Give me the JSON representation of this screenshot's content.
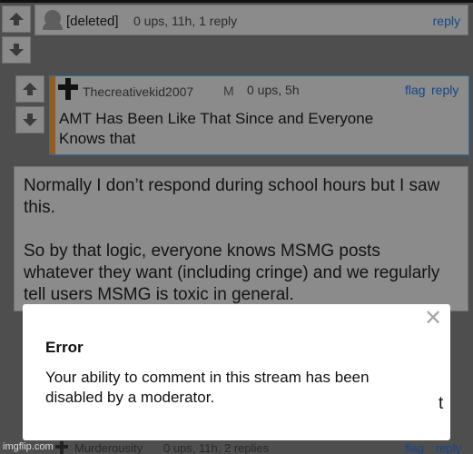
{
  "comment1": {
    "author": "[deleted]",
    "meta": "0 ups, 11h, 1 reply",
    "reply_label": "reply"
  },
  "comment2": {
    "author": "Thecreativekid2007",
    "badge": "M",
    "meta": "0 ups, 5h",
    "flag_label": "flag",
    "reply_label": "reply",
    "text": "AMT Has Been Like That Since and Everyone Knows that"
  },
  "comment3": {
    "paragraph1": "Normally I don’t respond during school hours but I saw this.",
    "paragraph2": "So by that logic, everyone knows MSMG posts whatever they want (including cringe) and we regularly tell users MSMG is toxic in general.",
    "trailing_char": "t"
  },
  "comment4": {
    "author": "Murderousity",
    "meta": "0 ups, 11h, 2 replies",
    "flag_label": "flag",
    "reply_label": "reply"
  },
  "modal": {
    "title": "Error",
    "message": "Your ability to comment in this stream has been disabled by a moderator.",
    "close_symbol": "✕"
  },
  "watermark": "imgflip.com",
  "colors": {
    "link": "#14478a",
    "overlay": "#4e4e4e",
    "reply_stripe": "#9a5a1a",
    "reply_border": "#2e6e9a"
  }
}
